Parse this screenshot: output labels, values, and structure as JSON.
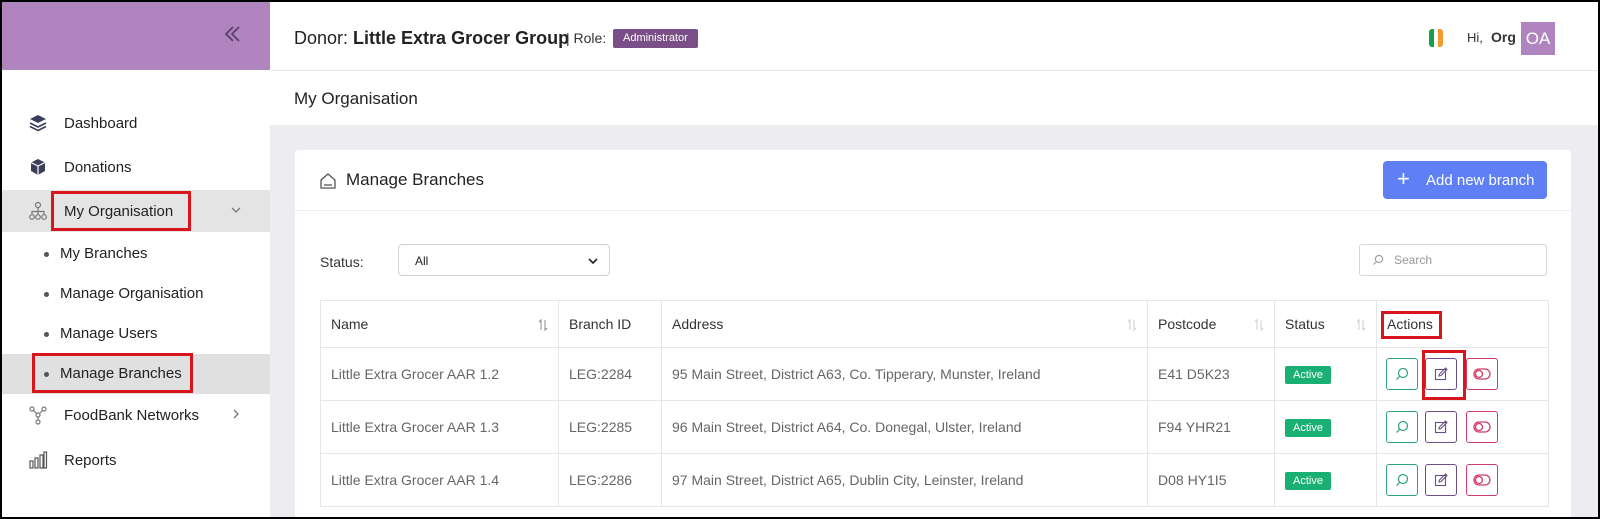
{
  "sidebar": {
    "items": [
      {
        "label": "Dashboard",
        "icon": "layers-icon"
      },
      {
        "label": "Donations",
        "icon": "box-icon"
      },
      {
        "label": "My Organisation",
        "icon": "org-chart-icon"
      },
      {
        "label": "FoodBank Networks",
        "icon": "network-icon"
      },
      {
        "label": "Reports",
        "icon": "bar-chart-icon"
      }
    ],
    "subitems": [
      {
        "label": "My Branches"
      },
      {
        "label": "Manage Organisation"
      },
      {
        "label": "Manage Users"
      },
      {
        "label": "Manage Branches"
      }
    ]
  },
  "header": {
    "donor_label": "Donor:",
    "donor_name": "Little Extra Grocer Group",
    "sep": "|",
    "role_label": "Role:",
    "role": "Administrator",
    "greeting": "Hi,",
    "user": "Org",
    "avatar": "OA"
  },
  "page": {
    "title": "My Organisation"
  },
  "card": {
    "title": "Manage Branches",
    "add_label": "Add new branch",
    "status_label": "Status:",
    "status_value": "All",
    "search_placeholder": "Search"
  },
  "table": {
    "headers": [
      "Name",
      "Branch ID",
      "Address",
      "Postcode",
      "Status",
      "Actions"
    ],
    "rows": [
      {
        "name": "Little Extra Grocer AAR 1.2",
        "id": "LEG:2284",
        "address": "95 Main Street, District A63, Co. Tipperary, Munster, Ireland",
        "postcode": "E41 D5K23",
        "status": "Active"
      },
      {
        "name": "Little Extra Grocer AAR 1.3",
        "id": "LEG:2285",
        "address": "96 Main Street, District A64, Co. Donegal, Ulster, Ireland",
        "postcode": "F94 YHR21",
        "status": "Active"
      },
      {
        "name": "Little Extra Grocer AAR 1.4",
        "id": "LEG:2286",
        "address": "97 Main Street, District A65, Dublin City, Leinster, Ireland",
        "postcode": "D08 HY1I5",
        "status": "Active"
      }
    ]
  },
  "colors": {
    "sidebar_accent": "#b085bf",
    "role_badge": "#7a4f87",
    "primary_button": "#5f7ff5",
    "active_badge": "#1aaf73",
    "highlight_box": "#d8141c"
  }
}
